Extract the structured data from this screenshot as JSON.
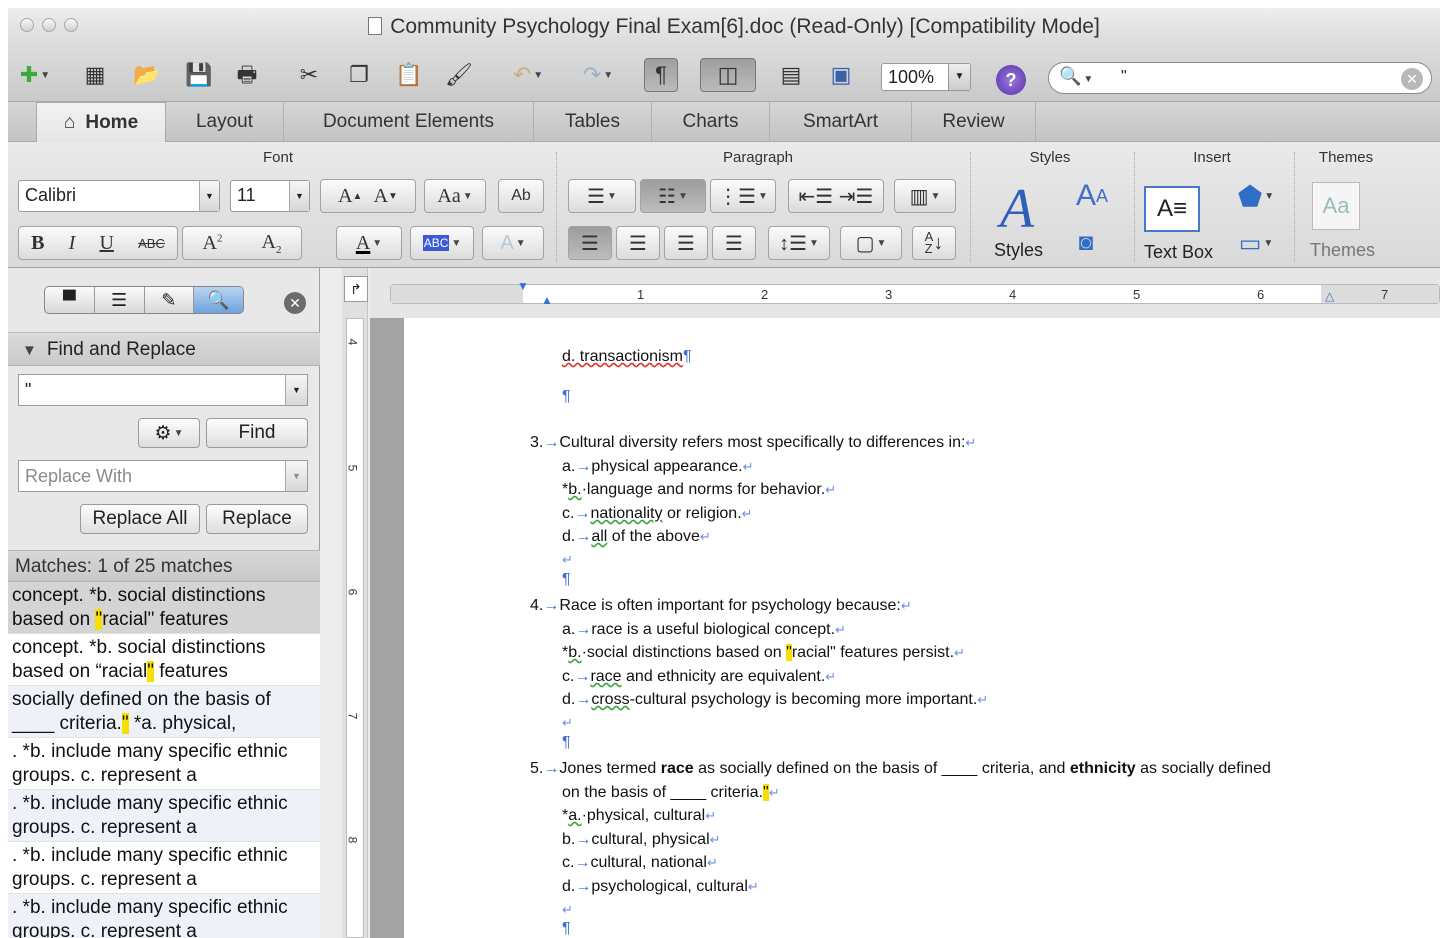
{
  "window": {
    "title": "Community Psychology Final Exam[6].doc (Read-Only) [Compatibility Mode]"
  },
  "toolbar": {
    "zoom": "100%",
    "search_value": "\""
  },
  "tabs": [
    "Home",
    "Layout",
    "Document Elements",
    "Tables",
    "Charts",
    "SmartArt",
    "Review"
  ],
  "ribbon": {
    "groups": {
      "font": "Font",
      "paragraph": "Paragraph",
      "styles": "Styles",
      "insert": "Insert",
      "themes": "Themes"
    },
    "font_name": "Calibri",
    "font_size": "11",
    "styles_label": "Styles",
    "textbox_label": "Text Box",
    "themes_label": "Themes"
  },
  "sidebar": {
    "panel_title": "Find and Replace",
    "find_value": "\"",
    "replace_placeholder": "Replace With",
    "find_button": "Find",
    "replace_all_button": "Replace All",
    "replace_button": "Replace",
    "matches_text": "Matches: 1 of 25 matches",
    "results": [
      {
        "pre": "concept. *b. social distinctions based on ",
        "match": "\"",
        "post": "racial\" features"
      },
      {
        "pre": "concept. *b. social distinctions based on “racial",
        "match": "\"",
        "post": " features"
      },
      {
        "pre": "socially defined on the basis of ____ criteria.",
        "match": "\"",
        "post": " *a. physical,"
      },
      {
        "pre": ". *b. include many specific ethnic groups. c. represent a",
        "match": "",
        "post": ""
      },
      {
        "pre": ". *b. include many specific ethnic groups. c. represent a",
        "match": "",
        "post": ""
      },
      {
        "pre": ". *b. include many specific ethnic groups. c. represent a",
        "match": "",
        "post": ""
      },
      {
        "pre": ". *b. include many specific ethnic groups. c. represent a",
        "match": "",
        "post": ""
      }
    ]
  },
  "ruler": {
    "h_numbers": [
      "1",
      "2",
      "3",
      "4",
      "5",
      "6",
      "7"
    ],
    "v_numbers": [
      "4",
      "5",
      "6",
      "7",
      "8"
    ]
  },
  "document": {
    "q2d": "d. transactionism",
    "q3": {
      "num": "3.",
      "stem": "Cultural diversity refers most specifically to differences in:",
      "a": "physical appearance.",
      "b": "language and norms for behavior.",
      "c_pre": "nationality",
      "c_post": " or religion.",
      "d_pre": "all",
      "d_post": " of the above"
    },
    "q4": {
      "num": "4.",
      "stem": "Race is often important for psychology because:",
      "a": "race is a useful biological concept.",
      "b_pre": "social distinctions based on ",
      "b_q": "\"",
      "b_post": "racial\" features persist.",
      "c_pre": "race",
      "c_post": " and ethnicity are equivalent.",
      "d_pre": "cross",
      "d_post": "-cultural psychology is becoming more important."
    },
    "q5": {
      "num": "5.",
      "stem_1": "Jones termed ",
      "stem_race": "race",
      "stem_2": " as socially defined on the basis of ____ criteria, and ",
      "stem_eth": "ethnicity",
      "stem_3": " as socially defined",
      "stem_line2": "on the basis of ____ criteria.",
      "stem_q": "\"",
      "a": "physical, cultural",
      "b": "cultural, physical",
      "c": "cultural, national",
      "d": "psychological, cultural"
    }
  }
}
